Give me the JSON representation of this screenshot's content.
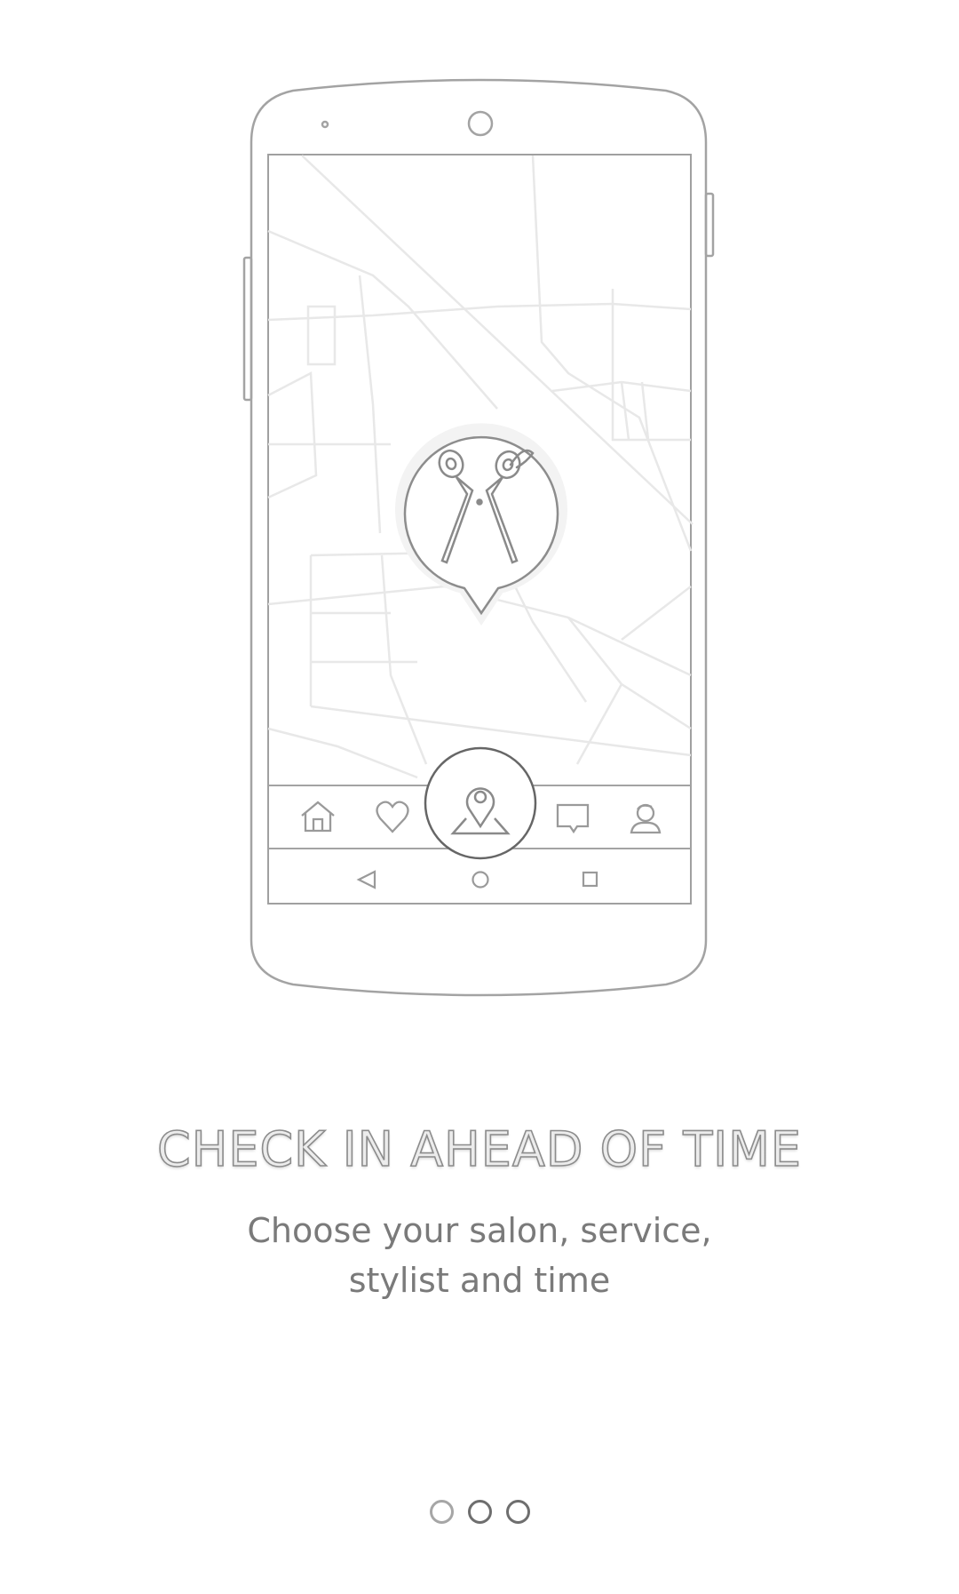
{
  "onboarding": {
    "headline": "CHECK IN AHEAD OF TIME",
    "subtitle_line1": "Choose your salon, service,",
    "subtitle_line2": "stylist and time",
    "page_count": 3,
    "current_page": 1
  },
  "illustration": {
    "map_pin_icon": "scissors-icon",
    "bottom_nav_icons": [
      "home-icon",
      "heart-icon",
      "map-location-icon",
      "chat-icon",
      "profile-icon"
    ],
    "system_nav_icons": [
      "back-icon",
      "home-circle-icon",
      "recents-icon"
    ]
  },
  "colors": {
    "line": "#9a9a9a",
    "map_line": "#e6e6e6",
    "headline_text": "#8c8c8c",
    "subtitle_text": "#7a7a7a",
    "background": "#ffffff"
  }
}
